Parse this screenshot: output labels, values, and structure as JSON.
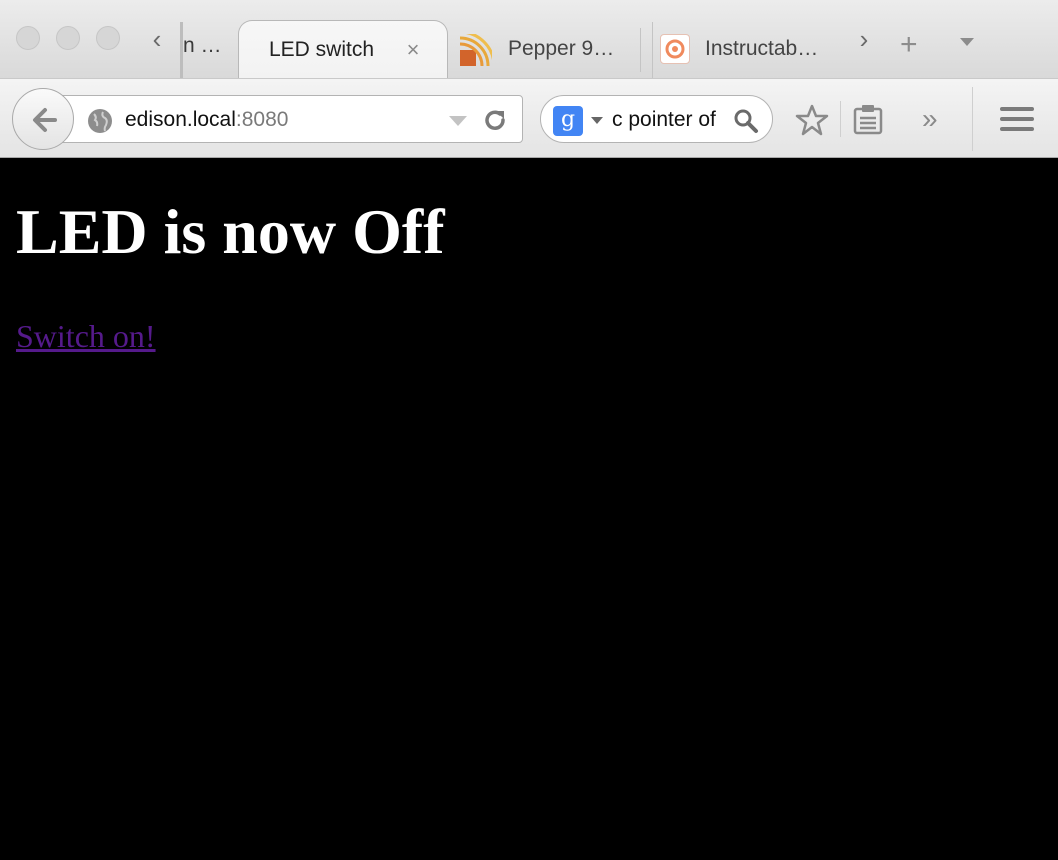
{
  "browser": {
    "tabs": [
      {
        "title": "n …",
        "state": "clipped"
      },
      {
        "title": "LED switch",
        "state": "active"
      },
      {
        "title": "Pepper 9…",
        "state": "background",
        "icon": "rss-icon"
      },
      {
        "title": "Instructab…",
        "state": "background",
        "icon": "instructables-icon"
      }
    ],
    "url": {
      "host": "edison.local",
      "port": ":8080"
    },
    "search": {
      "engine": "Google",
      "engine_glyph": "g",
      "query": "c pointer of"
    },
    "icons": [
      "back-arrow-icon",
      "globe-icon",
      "reload-icon",
      "search-icon",
      "star-icon",
      "reading-list-icon",
      "overflow-chevron-icon",
      "hamburger-menu-icon",
      "new-tab-plus-icon",
      "tab-list-dropdown-icon"
    ]
  },
  "page": {
    "heading": "LED is now Off",
    "link_text": "Switch on!",
    "background_color": "#000000",
    "heading_color": "#ffffff",
    "link_color": "#551a8b"
  }
}
